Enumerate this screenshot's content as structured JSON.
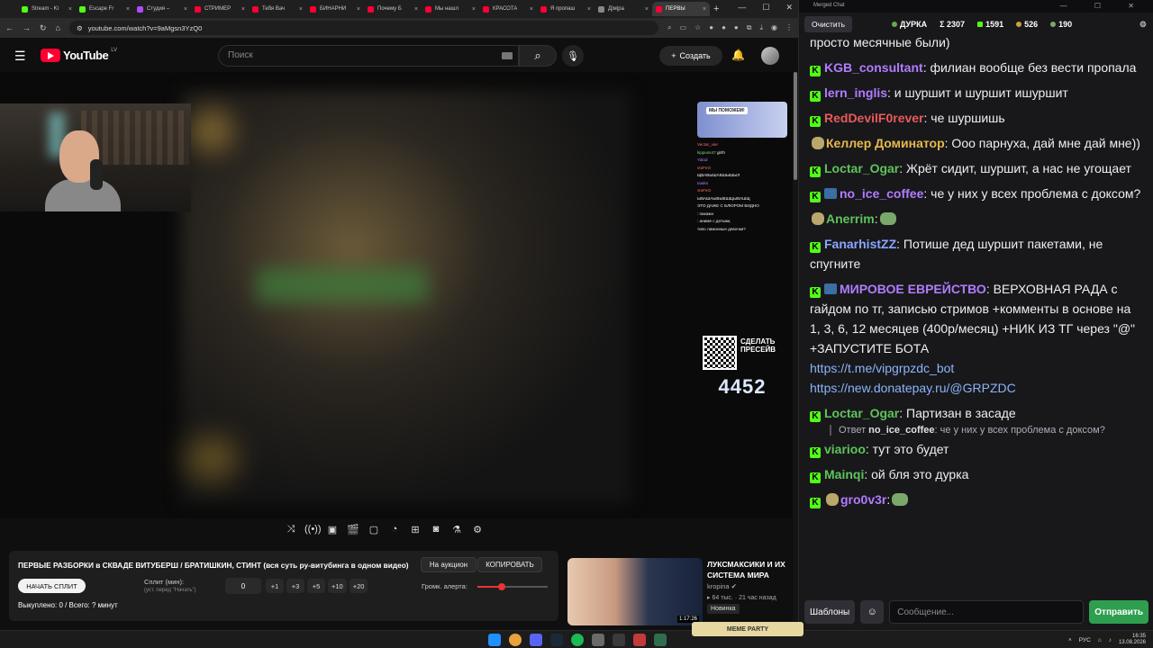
{
  "browser": {
    "tabs": [
      {
        "label": "Stream - Ki",
        "color": "#53fc18"
      },
      {
        "label": "Escape Fr",
        "color": "#53fc18"
      },
      {
        "label": "Студия –",
        "color": "#b04cff"
      },
      {
        "label": "СТРИМЕР",
        "color": "#ff0033"
      },
      {
        "label": "Тебя Вач",
        "color": "#ff0033"
      },
      {
        "label": "БИНАРНИ",
        "color": "#ff0033"
      },
      {
        "label": "Почему Б",
        "color": "#ff0033"
      },
      {
        "label": "Мы нашл",
        "color": "#ff0033"
      },
      {
        "label": "КРАСОТА",
        "color": "#ff0033"
      },
      {
        "label": "Я пропаш",
        "color": "#ff0033"
      },
      {
        "label": "Д|м|ра",
        "color": "#888888"
      },
      {
        "label": "ПЕРВЫ",
        "color": "#ff0033"
      }
    ],
    "url": "youtube.com/watch?v=9aMgsn3YzQ0"
  },
  "youtube": {
    "logo_text": "YouTube",
    "country": "LV",
    "search_placeholder": "Поиск",
    "create_label": "Создать"
  },
  "overlay": {
    "banner_text": "МЫ ПОМОЖЕМ!",
    "chat_lines": [
      {
        "name": "Vectar_vier",
        "text": ""
      },
      {
        "name": "kippuss47",
        "text": "girth"
      },
      {
        "name": "Yalad",
        "text": ""
      },
      {
        "name": "vtoFeO",
        "text": ""
      },
      {
        "name": "",
        "text": "ЩВАВЫШАВШЫШЫЛ"
      },
      {
        "name": "taaiks",
        "text": ""
      },
      {
        "name": "vtoFeO",
        "text": ""
      },
      {
        "name": "",
        "text": "ЫВАШАЫВЫВШЩЫВАШЩ"
      },
      {
        "name": "",
        "text": "ЭТО ДАЖЕ С БЛЮРОМ ВИДНО"
      },
      {
        "name": "",
        "text": ": пакажи"
      },
      {
        "name": "",
        "text": ": аниме с детьми,"
      },
      {
        "name": "",
        "text": "типо лимонные девочки?"
      }
    ],
    "qr_title": "СДЕЛАТЬ ПРЕСЕЙВ",
    "counter": "4452"
  },
  "video_controls": [
    "shuffle-icon",
    "radio-icon",
    "tts-icon",
    "clapper-icon",
    "frame-icon",
    "gauge-icon",
    "add-icon",
    "camera-icon",
    "flask-icon",
    "gear-icon"
  ],
  "panel": {
    "title": "ПЕРВЫЕ РАЗБОРКИ в СКВАДЕ ВИТУБЕРШ / БРАТИШКИН, СТИНТ (вся суть ру-витубинга в одном видео)",
    "auction_label": "На аукцион",
    "copy_label": "КОПИРОВАТЬ",
    "split_button": "НАЧАТЬ СПЛИТ",
    "split_label": "Сплит (мин):",
    "split_hint": "(уст. перед \"Начать\")",
    "split_value": "0",
    "steps": [
      "+1",
      "+3",
      "+5",
      "+10",
      "+20"
    ],
    "volume_label": "Громк. алерта:",
    "volume_level": 0.35,
    "bought": "Выкуплено: 0 / Всего: ? минут"
  },
  "recommended": {
    "title": "ЛУКСМАКСИКИ И ИХ СИСТЕМА МИРА",
    "channel": "kropina ✔",
    "meta": "▸ 64 тыс. · 21 час назад",
    "badge": "Новинка",
    "duration": "1:17:26"
  },
  "chat": {
    "window_title": "Merged Chat",
    "clear_label": "Очистить",
    "channel_label": "ДУРКА",
    "stat_total": "Σ 2307",
    "stat_kick": "1591",
    "stat_a": "526",
    "stat_b": "190",
    "messages": [
      {
        "name": "",
        "color": "#efeff1",
        "text": "просто месячные были)",
        "badge": ""
      },
      {
        "name": "KGB_consultant",
        "color": "#b17cff",
        "text": ": филиан вообще без вести пропала",
        "badge": "K"
      },
      {
        "name": "lern_inglis",
        "color": "#b17cff",
        "text": ": и шуршит и шуршит ишуршит",
        "badge": "K"
      },
      {
        "name": "RedDevilF0rever",
        "color": "#e85a5a",
        "text": ": че шуршишь",
        "badge": "K"
      },
      {
        "name": "Келлер Доминатор",
        "color": "#e6b84a",
        "text": ": Ооо парнуха, дай мне дай мне))",
        "badge": "E"
      },
      {
        "name": "Loctar_Ogar",
        "color": "#5fc35a",
        "text": ": Жрёт сидит, шуршит, а нас не угощает",
        "badge": "K"
      },
      {
        "name": "no_ice_coffee",
        "color": "#b17cff",
        "text": ": че у них у всех проблема с доксом?",
        "badge": "KB"
      },
      {
        "name": "Anerrim",
        "color": "#5fc35a",
        "text": ":",
        "badge": "E",
        "emote": true
      },
      {
        "name": "FanarhistZZ",
        "color": "#8aa6ff",
        "text": ": Потише дед шуршит пакетами, не спугните",
        "badge": "K"
      },
      {
        "name": "МИРОВОЕ ЕВРЕЙСТВО",
        "color": "#b17cff",
        "text": ": ВЕРХОВНАЯ РАДА с гайдом по тг, записью стримов +комменты в основе на 1, 3, 6, 12 месяцев (400р/месяц) +НИК ИЗ ТГ через \"@\" +ЗАПУСТИТЕ БОТА",
        "badge": "KB"
      },
      {
        "name": "Loctar_Ogar",
        "color": "#5fc35a",
        "text": ": Партизан в засаде",
        "badge": "K"
      },
      {
        "name": "viarioo",
        "color": "#5fc35a",
        "text": ": тут это будет",
        "badge": "K"
      },
      {
        "name": "Mainqi",
        "color": "#5fc35a",
        "text": ": ой бля это дурка",
        "badge": "K"
      },
      {
        "name": "gro0v3r",
        "color": "#b17cff",
        "text": ":",
        "badge": "KE",
        "emote": true
      }
    ],
    "links": [
      "https://t.me/vipgrpzdc_bot",
      "https://new.donatepay.ru/@GRPZDC"
    ],
    "reply_prefix": "Ответ",
    "reply_name": "no_ice_coffee",
    "reply_text": ": че у них у всех проблема с доксом?",
    "templates_label": "Шаблоны",
    "input_placeholder": "Сообщение...",
    "send_label": "Отправить"
  },
  "taskbar": {
    "meme_label": "МЕМЕ PARTY",
    "lang": "РУС",
    "time": "16:35",
    "date": "13.08.2026"
  }
}
